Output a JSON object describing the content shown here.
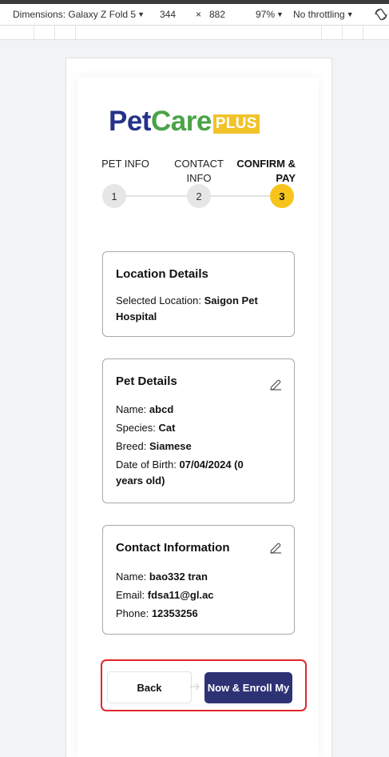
{
  "devtools": {
    "dimensions_label": "Dimensions: Galaxy Z Fold 5",
    "width": "344",
    "times": "×",
    "height": "882",
    "zoom": "97%",
    "throttling": "No throttling"
  },
  "logo": {
    "pet": "Pet",
    "care": "Care",
    "plus": "PLUS"
  },
  "stepper": {
    "steps": [
      {
        "label": "PET INFO",
        "number": "1"
      },
      {
        "label_line1": "CONTACT",
        "label_line2": "INFO",
        "number": "2"
      },
      {
        "label_line1": "CONFIRM &",
        "label_line2": "PAY",
        "number": "3"
      }
    ],
    "active_step": 3
  },
  "location": {
    "title": "Location Details",
    "selected_label": "Selected Location:",
    "selected_value_line1": "Saigon Pet",
    "selected_value_line2": "Hospital"
  },
  "pet": {
    "title": "Pet Details",
    "name_label": "Name:",
    "name_value": "abcd",
    "species_label": "Species:",
    "species_value": "Cat",
    "breed_label": "Breed:",
    "breed_value": "Siamese",
    "dob_label": "Date of Birth:",
    "dob_value_line1": "07/04/2024 (0",
    "dob_value_line2": "years old)"
  },
  "contact": {
    "title": "Contact Information",
    "name_label": "Name:",
    "name_value": "bao332 tran",
    "email_label": "Email:",
    "email_value": "fdsa11@gl.ac",
    "phone_label": "Phone:",
    "phone_value": "12353256"
  },
  "actions": {
    "back_label": "Back",
    "enroll_label": "Now & Enroll My"
  },
  "colors": {
    "brand_navy": "#26318a",
    "brand_green": "#4aa347",
    "brand_yellow": "#f2c22a",
    "step_active": "#f6c41b",
    "primary_button": "#2d3275",
    "highlight_border": "#e0262b"
  }
}
